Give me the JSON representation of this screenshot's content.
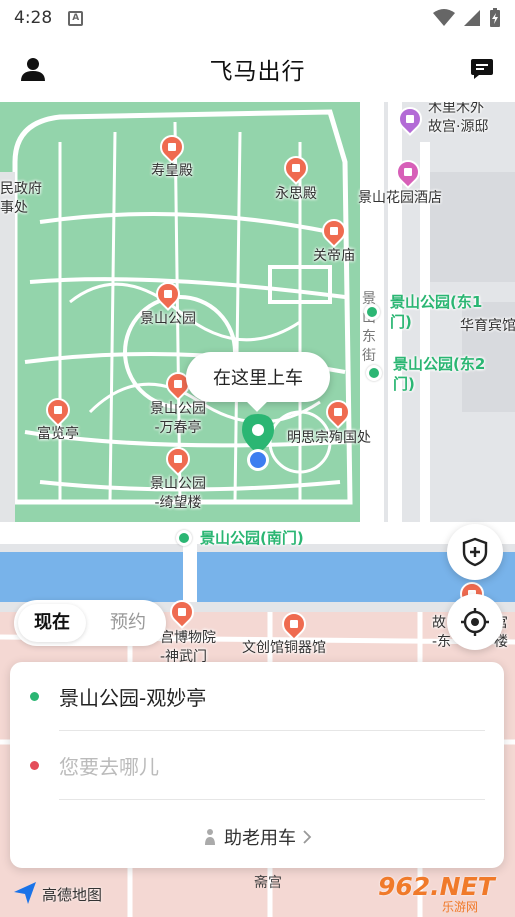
{
  "status_bar": {
    "time": "4:28",
    "notification_badge": "A"
  },
  "header": {
    "title": "飞马出行"
  },
  "map": {
    "pois": {
      "shouhuang": "寿皇殿",
      "yongsi": "永思殿",
      "guandi": "关帝庙",
      "jingshan": "景山公园",
      "wanchun": "景山公园\n-万春亭",
      "qiwang": "景山公园\n-绮望楼",
      "fulan": "富览亭",
      "mingsi": "明思宗殉国处",
      "hotel": "景山花园酒店",
      "mulimuwai": "木里木外\n故宫·源邸",
      "left_edge": "民政府\n事处",
      "huayu": "华育宾馆",
      "palace_museum": "宫博物院\n-神武门",
      "wenchuang": "文创馆铜器馆",
      "palace_east": "故\n-东",
      "gugong_right": "宫\n楼",
      "jingshan_east_rd": "景\n山\n东\n街"
    },
    "green_stops": {
      "east1": "景山公园(东1\n门)",
      "east2": "景山公园(东2\n门)",
      "south": "景山公园(南门)"
    },
    "bubble": "在这里上车",
    "footer": {
      "logo_text": "高德地图",
      "watermark": "962.NET",
      "watermark_sub": "乐游网",
      "place": "斋宫"
    }
  },
  "time_toggle": {
    "now": "现在",
    "reserve": "预约"
  },
  "panel": {
    "pickup": "景山公园-观妙亭",
    "destination_placeholder": "您要去哪儿",
    "elder_service": "助老用车"
  },
  "colors": {
    "park": "#93d4ab",
    "road": "#ffffff",
    "water": "#78b3ea",
    "accent_green": "#2bb673",
    "pin_red": "#ef6b50",
    "dest_red": "#e44d5a"
  }
}
